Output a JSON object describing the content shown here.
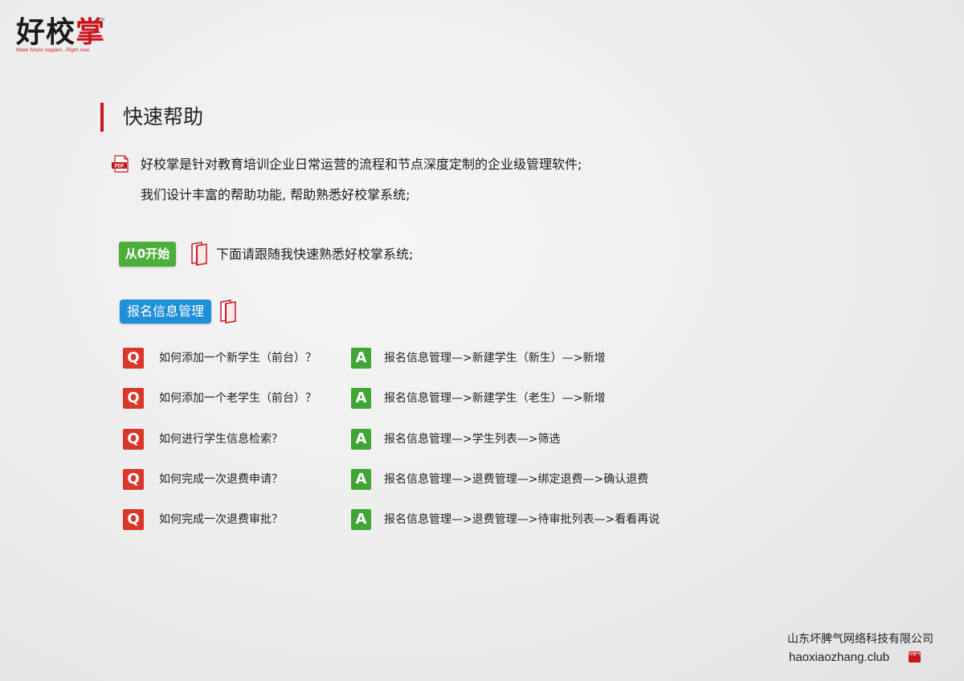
{
  "logo": {
    "char1": "好",
    "char2": "校",
    "char3": "掌",
    "tm": "TM",
    "slogan": "Make future happen...Right now."
  },
  "section": {
    "title": "快速帮助"
  },
  "intro": {
    "line1": "好校掌是针对教育培训企业日常运营的流程和节点深度定制的企业级管理软件;",
    "line2": "我们设计丰富的帮助功能, 帮助熟悉好校掌系统;",
    "pdf_icon_label": "PDF"
  },
  "start": {
    "badge": "从0开始",
    "text": "下面请跟随我快速熟悉好校掌系统;"
  },
  "module": {
    "title": "报名信息管理"
  },
  "qa": [
    {
      "q_badge": "Q",
      "question": "如何添加一个新学生（前台）？",
      "a_badge": "A",
      "answer": "报名信息管理—>新建学生（新生）—>新增"
    },
    {
      "q_badge": "Q",
      "question": "如何添加一个老学生（前台）？",
      "a_badge": "A",
      "answer": "报名信息管理—>新建学生（老生）—>新增"
    },
    {
      "q_badge": "Q",
      "question": "如何进行学生信息检索？",
      "a_badge": "A",
      "answer": "报名信息管理—>学生列表—>筛选"
    },
    {
      "q_badge": "Q",
      "question": "如何完成一次退费申请？",
      "a_badge": "A",
      "answer": "报名信息管理—>退费管理—>绑定退费—>确认退费"
    },
    {
      "q_badge": "Q",
      "question": "如何完成一次退费审批？",
      "a_badge": "A",
      "answer": "报名信息管理—>退费管理—>待审批列表—>看看再说"
    }
  ],
  "footer": {
    "company": "山东坏脾气网络科技有限公司",
    "website": "haoxiaozhang.club",
    "stamp": "坏脾气"
  },
  "colors": {
    "brand_red": "#c8161d",
    "q_red": "#d9362c",
    "a_green": "#3fa535",
    "start_green": "#4caf3c",
    "module_blue": "#1f8fd6"
  }
}
